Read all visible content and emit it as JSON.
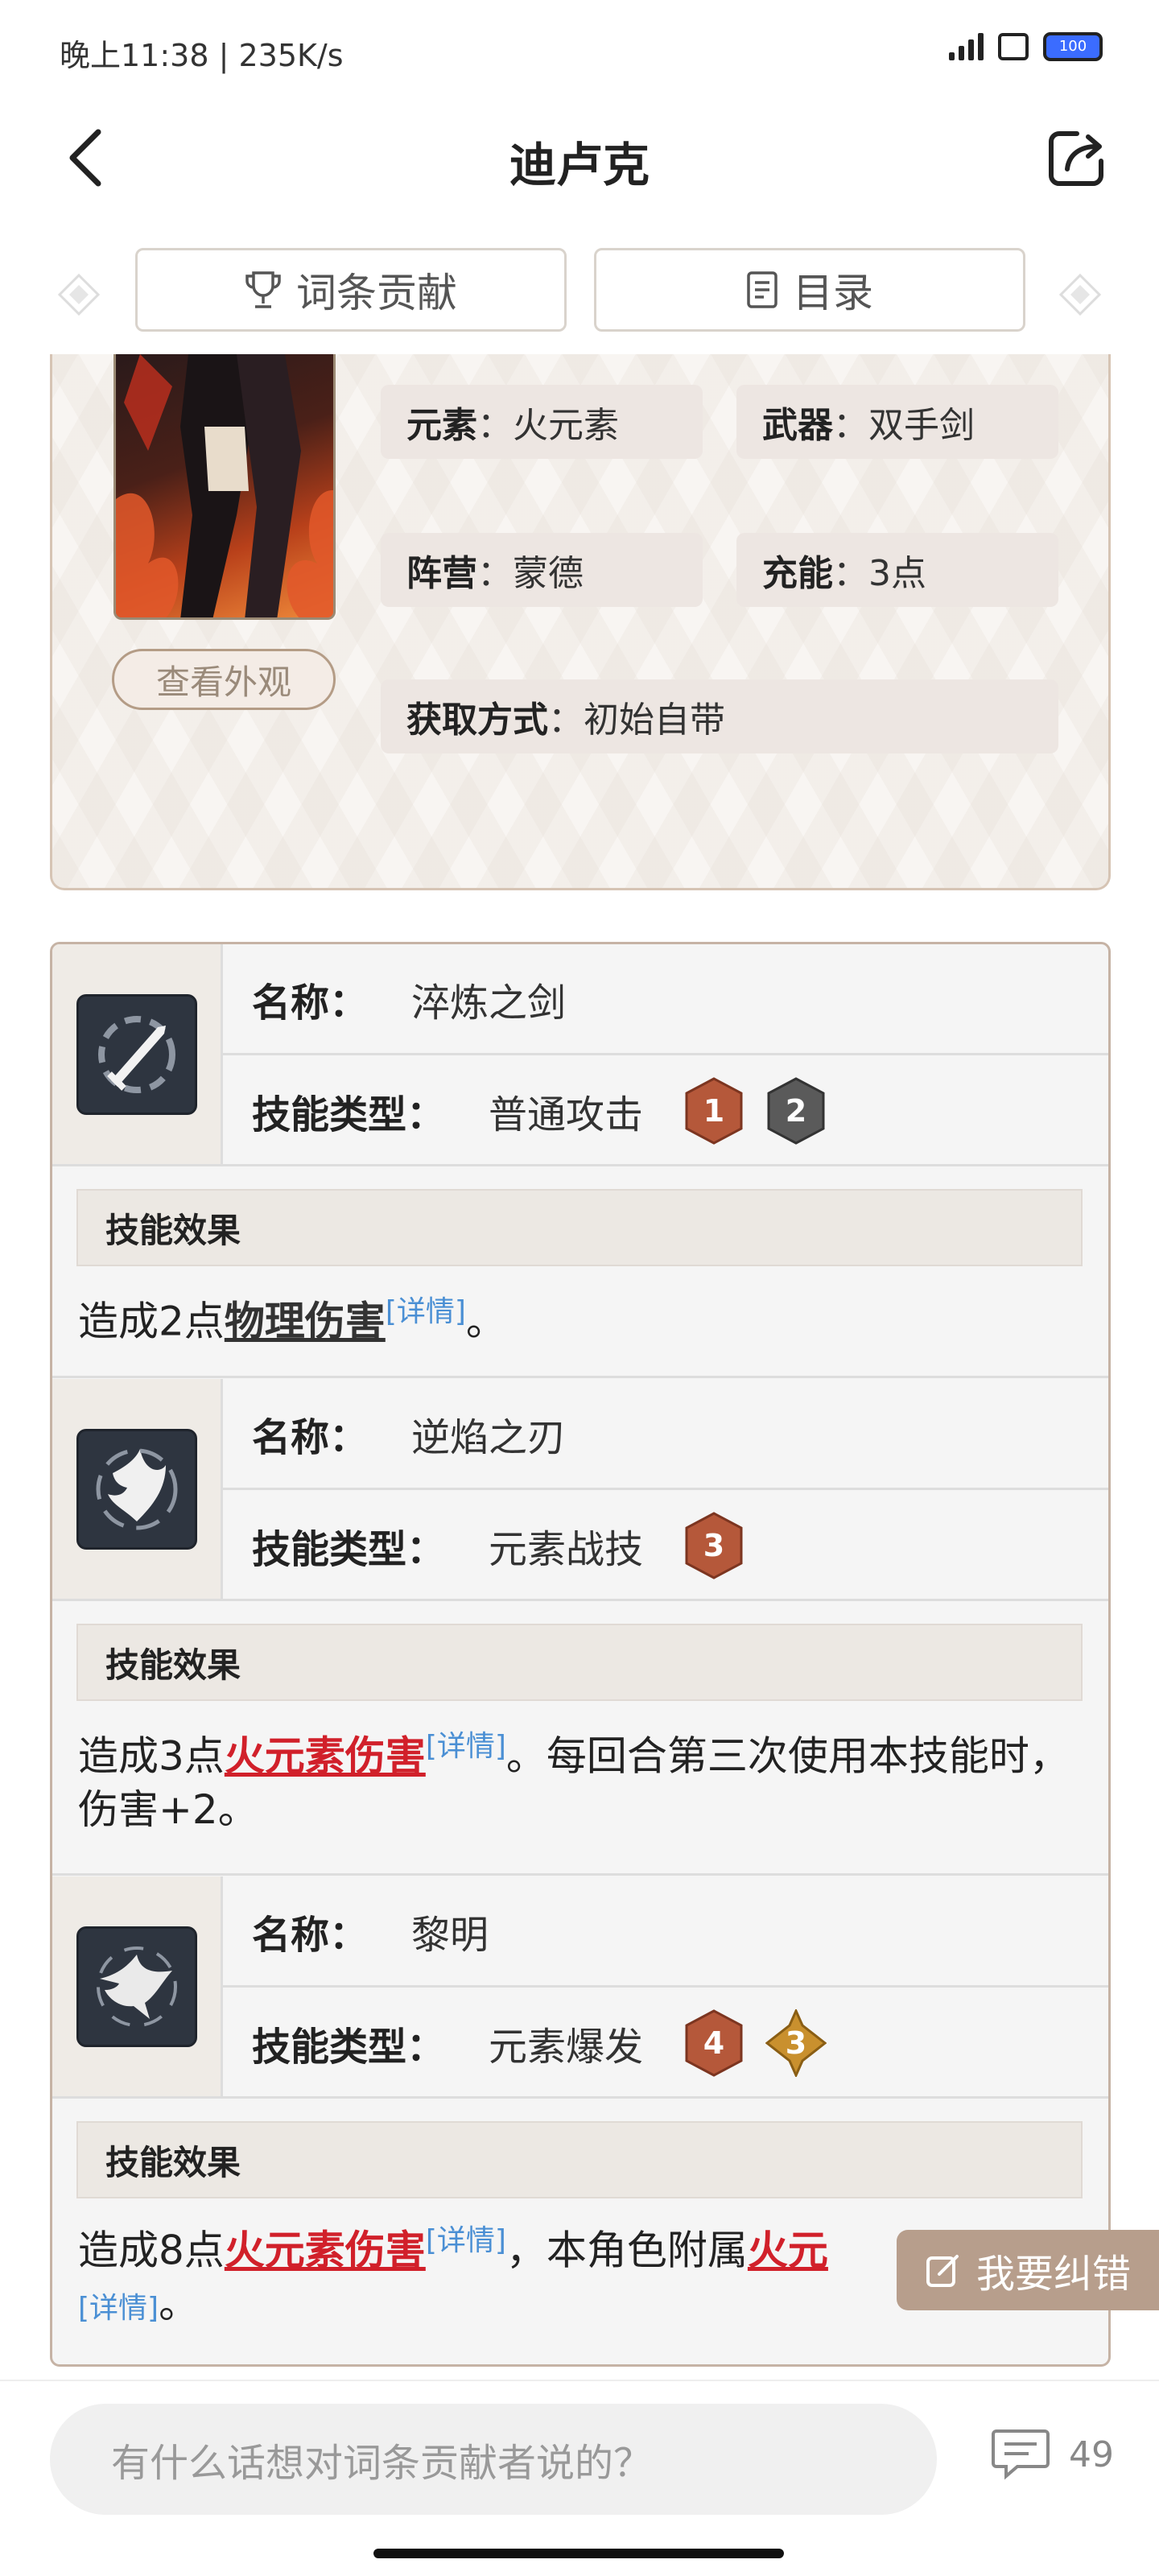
{
  "status_bar": {
    "time": "晚上11:38 | 235K/s",
    "battery": "100"
  },
  "header": {
    "title": "迪卢克"
  },
  "tabs": [
    {
      "label": "词条贡献"
    },
    {
      "label": "目录"
    }
  ],
  "character": {
    "view_button": "查看外观",
    "attributes": [
      {
        "key": "元素",
        "value": "火元素"
      },
      {
        "key": "武器",
        "value": "双手剑"
      },
      {
        "key": "阵营",
        "value": "蒙德"
      },
      {
        "key": "充能",
        "value": "3点"
      },
      {
        "key": "获取方式",
        "value": "初始自带"
      }
    ]
  },
  "skills": {
    "name_label": "名称：",
    "type_label": "技能类型：",
    "effect_label": "技能效果",
    "detail_link": "[详情]",
    "items": [
      {
        "name": "淬炼之剑",
        "type": "普通攻击",
        "costs": [
          {
            "value": "1",
            "color": "#b5583a"
          },
          {
            "value": "2",
            "color": "#5a5a5a"
          }
        ],
        "effect": {
          "pre": "造成2点",
          "term": "物理伤害",
          "post": "。"
        }
      },
      {
        "name": "逆焰之刃",
        "type": "元素战技",
        "costs": [
          {
            "value": "3",
            "color": "#b5583a"
          }
        ],
        "effect": {
          "pre": "造成3点",
          "term": "火元素伤害",
          "post": "。每回合第三次使用本技能时，伤害+2。"
        }
      },
      {
        "name": "黎明",
        "type": "元素爆发",
        "costs": [
          {
            "value": "4",
            "color": "#b5583a"
          },
          {
            "value": "3",
            "color": "#c9902e"
          }
        ],
        "effect": {
          "pre": "造成8点",
          "term": "火元素伤害",
          "mid": "，本角色附属",
          "term2": "火元",
          "post": "。"
        }
      }
    ]
  },
  "correction_button": "我要纠错",
  "comment_bar": {
    "placeholder": "有什么话想对词条贡献者说的？",
    "count": "49"
  }
}
